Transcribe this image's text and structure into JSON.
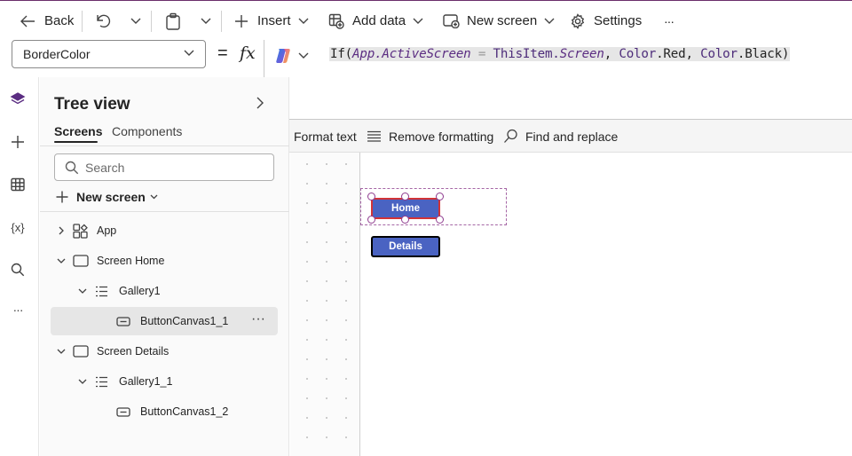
{
  "toolbar": {
    "back_label": "Back",
    "insert_label": "Insert",
    "add_data_label": "Add data",
    "new_screen_label": "New screen",
    "settings_label": "Settings",
    "more_label": "···"
  },
  "formula_bar": {
    "property": "BorderColor",
    "equals": "=",
    "fx": "fx",
    "formula": {
      "t1": "If(",
      "t2": "App",
      "t3": ".",
      "t4": "ActiveScreen",
      "t5": " = ",
      "t6": "ThisItem",
      "t7": ".",
      "t8": "Screen",
      "t9": ", ",
      "t10": "Color",
      "t11": ".Red, ",
      "t12": "Color",
      "t13": ".Black)"
    }
  },
  "format_bar": {
    "format_text": "Format text",
    "remove_formatting": "Remove formatting",
    "find_replace": "Find and replace"
  },
  "rail": {
    "variables_label": "{x}",
    "more_label": "···"
  },
  "tree": {
    "title": "Tree view",
    "tabs": [
      "Screens",
      "Components"
    ],
    "search_placeholder": "Search",
    "new_screen_label": "New screen",
    "nodes": [
      {
        "label": "App"
      },
      {
        "label": "Screen Home"
      },
      {
        "label": "Gallery1"
      },
      {
        "label": "ButtonCanvas1_1"
      },
      {
        "label": "Screen Details"
      },
      {
        "label": "Gallery1_1"
      },
      {
        "label": "ButtonCanvas1_2"
      }
    ],
    "node_more": "···"
  },
  "canvas": {
    "buttons": [
      {
        "label": "Home",
        "border": "#d13438"
      },
      {
        "label": "Details",
        "border": "#000000"
      }
    ]
  },
  "colors": {
    "accent": "#742774",
    "button_fill": "#4a63c2"
  }
}
